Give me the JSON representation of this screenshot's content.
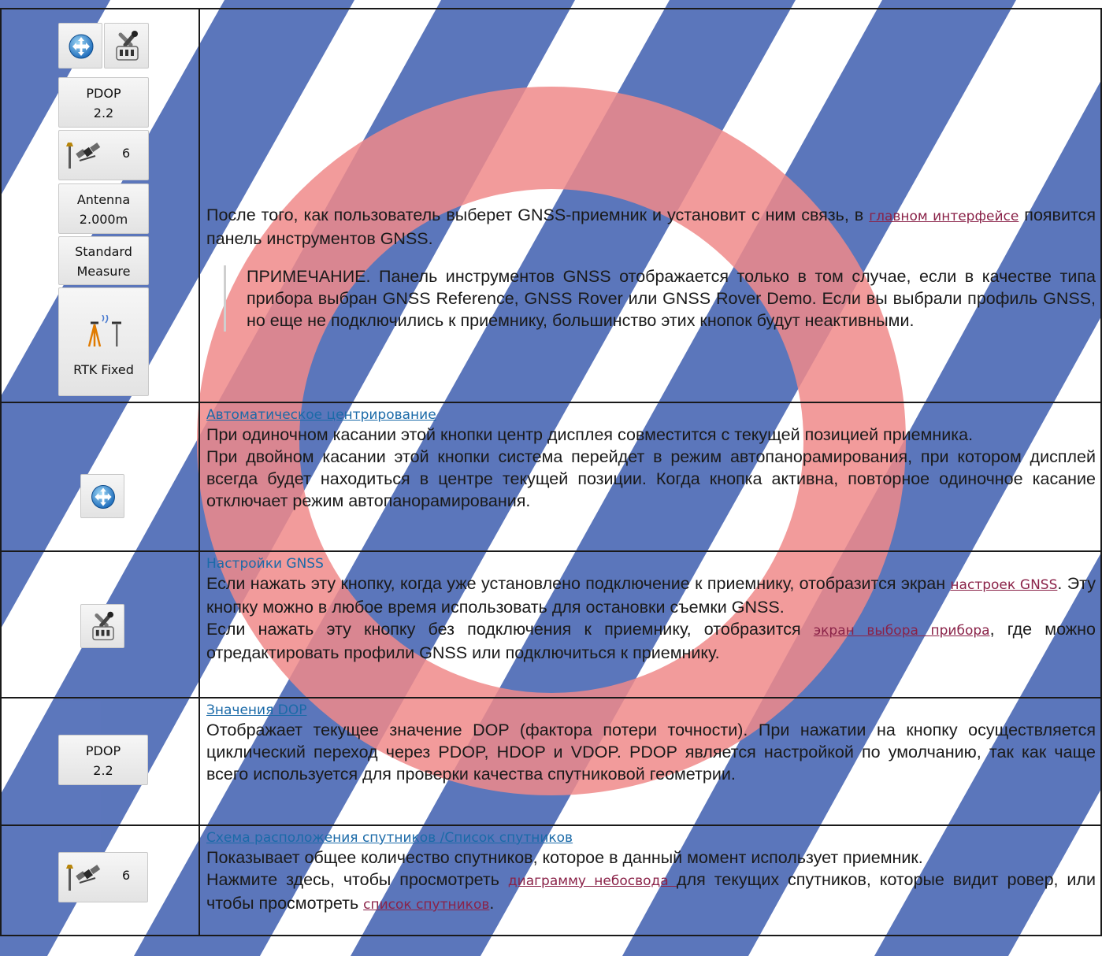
{
  "toolbar": {
    "pdop_label": "PDOP",
    "pdop_value": "2.2",
    "sat_count": "6",
    "antenna_label": "Antenna",
    "antenna_value": "2.000m",
    "measure_line1": "Standard",
    "measure_line2": "Measure",
    "rtk_status": "RTK Fixed"
  },
  "intro": {
    "text_before": "После того, как пользователь выберет GNSS-приемник и установит с ним связь, в ",
    "link_main": "главном интерфейсе",
    "text_after": " появится панель инструментов GNSS.",
    "note": "ПРИМЕЧАНИЕ. Панель инструментов GNSS отображается только в том случае, если в качестве типа прибора выбран GNSS Reference, GNSS Rover или GNSS Rover Demo. Если вы выбрали профиль GNSS, но еще не подключились к приемнику, большинство этих кнопок будут неактивными."
  },
  "rows": {
    "autocenter": {
      "title": "Автоматическое центрирование",
      "p1": "При одиночном касании этой кнопки центр дисплея совместится с текущей позицией при­емника.",
      "p2": "При двойном касании этой кнопки система перейдет в режим автопанорамирования, при котором дисплей всегда будет находиться в центре текущей позиции. Когда кнопка актив­на, повторное одиночное касание отключает режим автопанорамирования."
    },
    "settings": {
      "title": "Настройки GNSS",
      "p1_before": "Если нажать эту кнопку, когда уже установлено подключение к приемнику, отобразится экран ",
      "p1_link": "настроек GNSS",
      "p1_after": ". Эту кнопку можно в любое время использовать для остановки съемки GNSS.",
      "p2_before": "Если нажать эту кнопку без подключения к приемнику, отобразится ",
      "p2_link": "экран выбора прибора",
      "p2_after": ", где можно отредактировать профили GNSS или подключиться к приемнику."
    },
    "dop": {
      "title": "Значения DOP",
      "btn_label": "PDOP",
      "btn_value": "2.2",
      "p1": "Отображает текущее значение DOP (фактора потери точности). При нажатии на кнопку осуществляется циклический переход через PDOP, HDOP и VDOP. PDOP является на­стройкой по умолчанию, так как чаще всего используется для проверки качества спутнико­вой геометрии."
    },
    "sats": {
      "title": "Схема расположения спутников /Список спутников",
      "btn_count": "6",
      "p1": "Показывает общее количество спутников, которое в данный момент использует приемник.",
      "p2_before": "Нажмите здесь, чтобы просмотреть ",
      "p2_link1": "диаграмму небосвода ",
      "p2_mid": "для текущих спутников, которые видит ровер, или чтобы просмотреть ",
      "p2_link2": "список спутников",
      "p2_after": "."
    }
  },
  "colors": {
    "watermark_ring": "#f08a8a",
    "watermark_stripes": "#3f5fb0",
    "heading": "#1a6aa8",
    "link": "#8a2248"
  }
}
